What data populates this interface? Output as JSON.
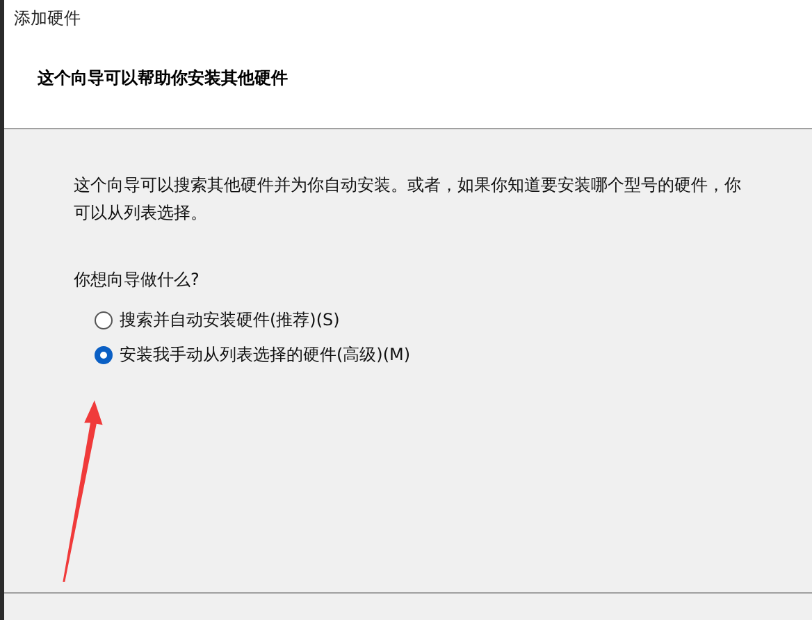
{
  "window": {
    "title": "添加硬件"
  },
  "header": {
    "heading": "这个向导可以帮助你安装其他硬件"
  },
  "body": {
    "description": "这个向导可以搜索其他硬件并为你自动安装。或者，如果你知道要安装哪个型号的硬件，你可以从列表选择。",
    "question": "你想向导做什么?",
    "options": [
      {
        "label": "搜索并自动安装硬件(推荐)(S)",
        "selected": false
      },
      {
        "label": "安装我手动从列表选择的硬件(高级)(M)",
        "selected": true
      }
    ]
  }
}
